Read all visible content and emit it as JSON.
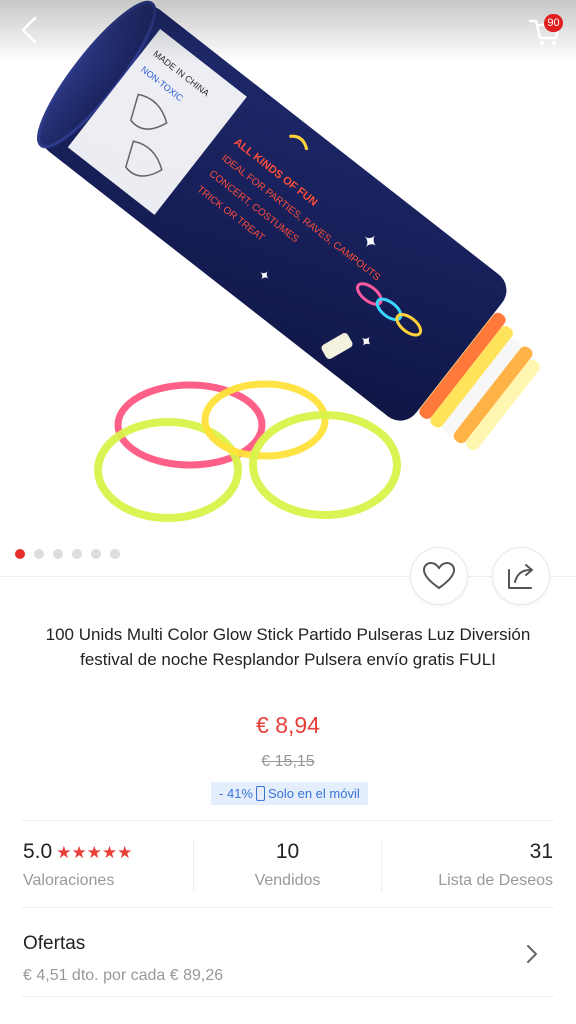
{
  "header": {
    "cart_count": "90"
  },
  "gallery": {
    "total": 6,
    "active_index": 0,
    "package_text": {
      "made_in": "MADE IN CHINA",
      "non_toxic": "NON-TOXIC",
      "kinds": "ALL KINDS OF FUN",
      "uses": "IDEAL FOR PARTIES, RAVES, CAMPOUTS",
      "events": "CONCERT, COSTUMES",
      "trick": "TRICK OR TREAT"
    }
  },
  "product": {
    "title": "100 Unids Multi Color Glow Stick Partido Pulseras Luz Diversión festival de noche Resplandor Pulsera envío gratis FULI",
    "price": "€ 8,94",
    "old_price": "€ 15,15",
    "discount": "- 41%",
    "mobile_only": "Solo en el móvil"
  },
  "stats": {
    "rating": {
      "value": "5.0",
      "stars": "★★★★★",
      "label": "Valoraciones"
    },
    "sold": {
      "value": "10",
      "label": "Vendidos"
    },
    "wishlist": {
      "value": "31",
      "label": "Lista de Deseos"
    }
  },
  "offers": {
    "title": "Ofertas",
    "subtitle": "€ 4,51 dto. por cada € 89,26"
  },
  "colors": {
    "accent": "#e8413b",
    "promo_bg": "#e4eefc",
    "promo_text": "#3974d6"
  }
}
